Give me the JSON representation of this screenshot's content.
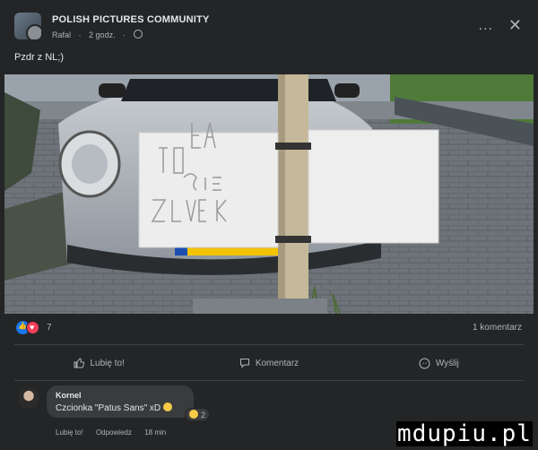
{
  "header": {
    "group_name": "POLISH PICTURES COMMUNITY",
    "author": "Rafal",
    "time": "2 godz.",
    "more_label": "...",
    "close_label": "✕"
  },
  "post": {
    "text": "Pzdr z NL;)"
  },
  "reactions": {
    "count": "7",
    "comments": "1 komentarz"
  },
  "actions": [
    {
      "label": "Lubię to!",
      "icon": "like-icon"
    },
    {
      "label": "Komentarz",
      "icon": "comment-icon"
    },
    {
      "label": "Wyślij",
      "icon": "messenger-icon"
    }
  ],
  "comment": {
    "author": "Kornel",
    "text": "Czcionka \"Patus Sans\" xD",
    "reaction_count": "2",
    "like_label": "Lubię to!",
    "reply_label": "Odpowiedz",
    "time": "18 min"
  },
  "watermark": "mdupiu.pl",
  "colors": {
    "background": "#242526",
    "text": "#e4e6eb",
    "muted": "#b0b3b8",
    "like_blue": "#1877f2",
    "love_red": "#f33e58"
  }
}
